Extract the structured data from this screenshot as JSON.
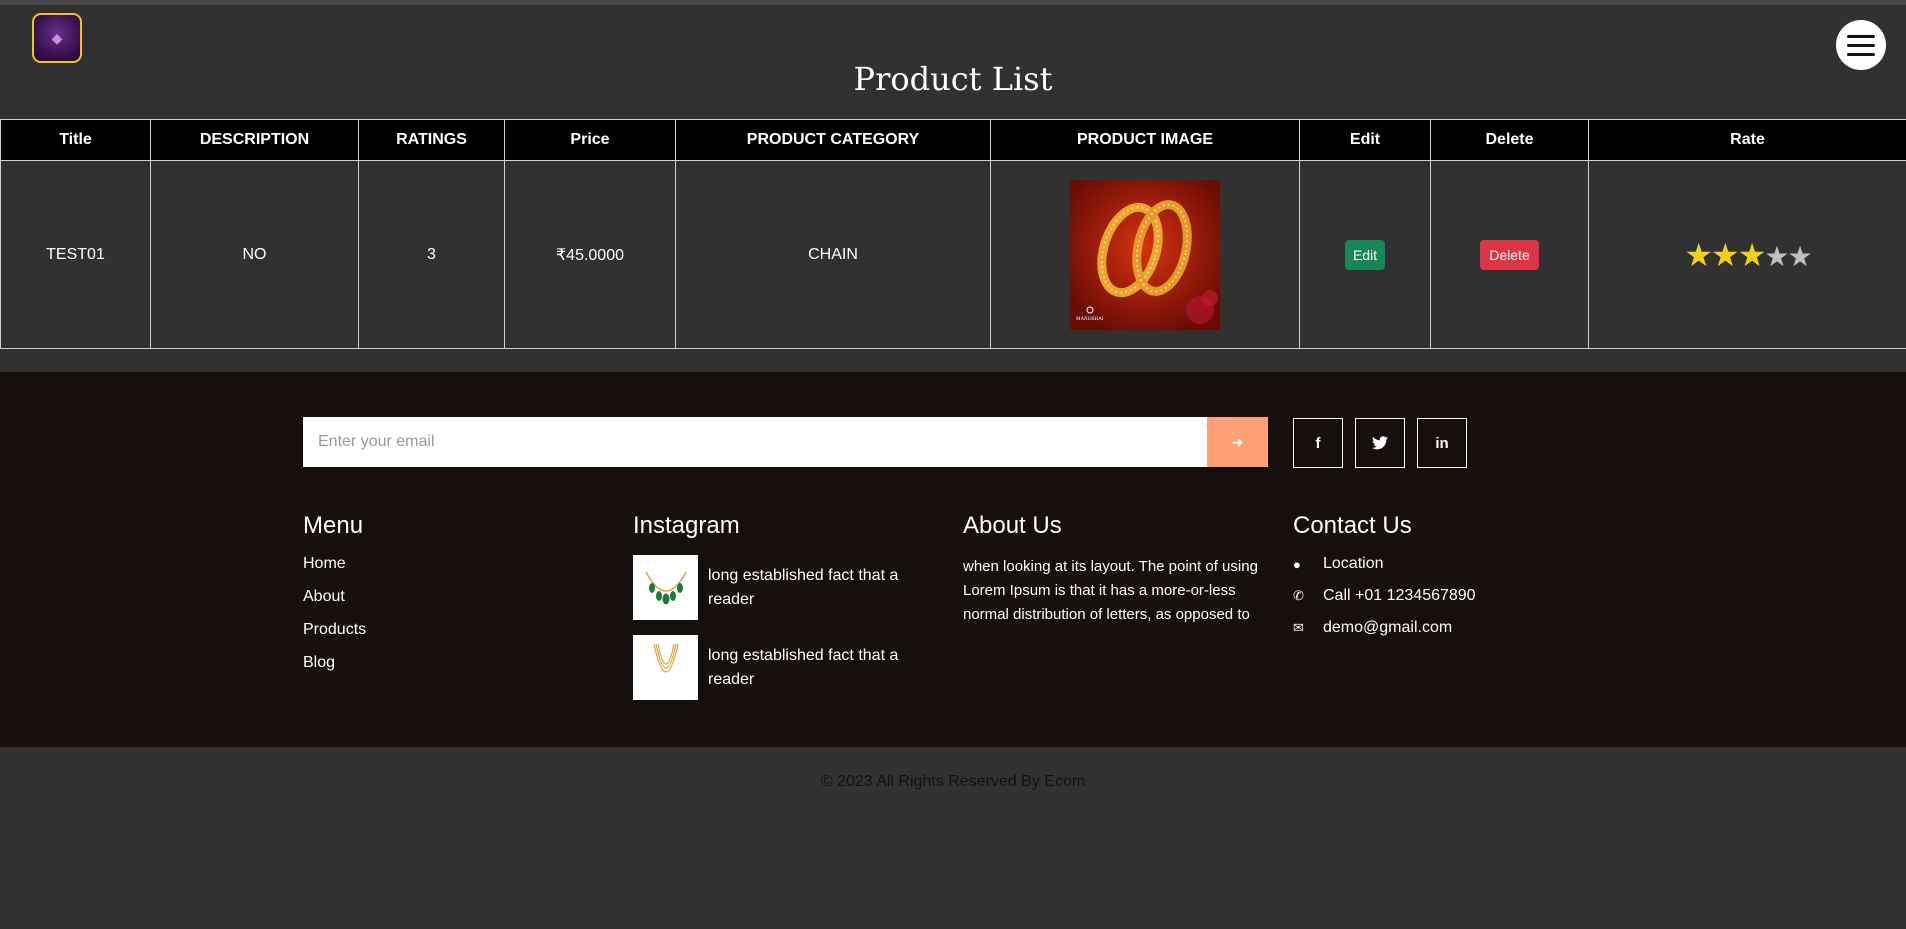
{
  "header": {
    "title": "Product List",
    "menu_icon": "hamburger-icon",
    "logo_icon": "gem-logo-icon"
  },
  "table": {
    "headers": [
      "Title",
      "DESCRIPTION",
      "RATINGS",
      "Price",
      "PRODUCT CATEGORY",
      "PRODUCT IMAGE",
      "Edit",
      "Delete",
      "Rate"
    ],
    "rows": [
      {
        "title": "TEST01",
        "description": "NO",
        "ratings": "3",
        "price": "₹45.0000",
        "category": "CHAIN",
        "image_icon": "gold-bangles-image",
        "image_caption": "MANUBHAI",
        "edit_label": "Edit",
        "delete_label": "Delete",
        "rate_value": 3,
        "rate_max": 5
      }
    ]
  },
  "footer": {
    "email_placeholder": "Enter your email",
    "submit_icon": "arrow-right-icon",
    "socials": [
      {
        "icon": "facebook-icon",
        "glyph": "f"
      },
      {
        "icon": "twitter-icon",
        "glyph": "t"
      },
      {
        "icon": "linkedin-icon",
        "glyph": "in"
      }
    ],
    "menu": {
      "heading": "Menu",
      "links": [
        "Home",
        "About",
        "Products",
        "Blog"
      ]
    },
    "instagram": {
      "heading": "Instagram",
      "items": [
        {
          "text": "long established fact that a reader",
          "icon": "emerald-necklace-thumbnail"
        },
        {
          "text": "long established fact that a reader",
          "icon": "gold-chain-thumbnail"
        }
      ]
    },
    "about": {
      "heading": "About Us",
      "text": "when looking at its layout. The point of using Lorem Ipsum is that it has a more-or-less normal distribution of letters, as opposed to"
    },
    "contact": {
      "heading": "Contact Us",
      "location": "Location",
      "phone": "Call +01 1234567890",
      "email": "demo@gmail.com"
    }
  },
  "copyright": "© 2023 All Rights Reserved By Ecom",
  "colors": {
    "page_bg": "#313131",
    "footer_bg": "#150f0d",
    "edit_button": "#198754",
    "delete_button": "#dc3545",
    "subscribe_button": "#ff9f75",
    "star_on": "#f7d117",
    "star_off": "#bfbfbf"
  }
}
